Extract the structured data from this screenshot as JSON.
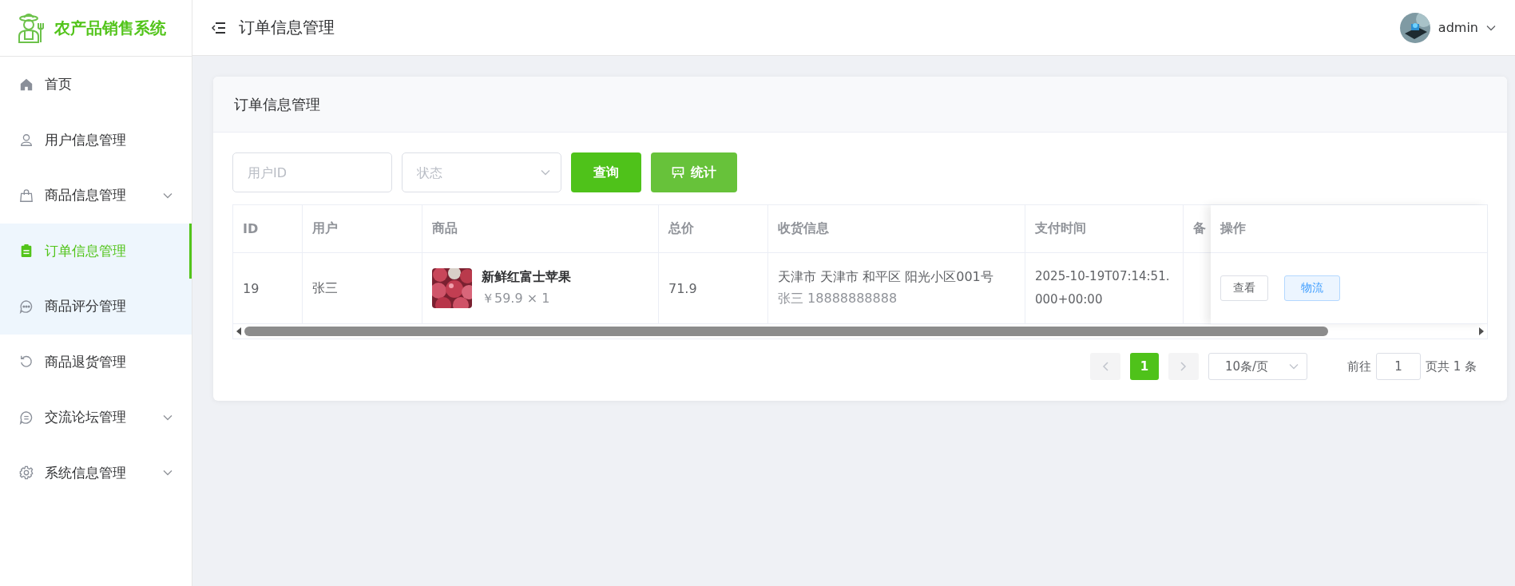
{
  "app": {
    "title": "农产品销售系统"
  },
  "sidebar": {
    "items": [
      {
        "label": "首页",
        "kind": "home",
        "expandable": false,
        "selected": false,
        "hovered": false
      },
      {
        "label": "用户信息管理",
        "kind": "user",
        "expandable": false,
        "selected": false,
        "hovered": false
      },
      {
        "label": "商品信息管理",
        "kind": "bag",
        "expandable": true,
        "selected": false,
        "hovered": false
      },
      {
        "label": "订单信息管理",
        "kind": "clipboard",
        "expandable": false,
        "selected": true,
        "hovered": false
      },
      {
        "label": "商品评分管理",
        "kind": "chat-dots",
        "expandable": false,
        "selected": false,
        "hovered": true
      },
      {
        "label": "商品退货管理",
        "kind": "refresh",
        "expandable": false,
        "selected": false,
        "hovered": false
      },
      {
        "label": "交流论坛管理",
        "kind": "chat-lines",
        "expandable": true,
        "selected": false,
        "hovered": false
      },
      {
        "label": "系统信息管理",
        "kind": "gear",
        "expandable": true,
        "selected": false,
        "hovered": false
      }
    ]
  },
  "header": {
    "title": "订单信息管理",
    "user": "admin"
  },
  "card": {
    "title": "订单信息管理"
  },
  "filters": {
    "user_id": {
      "placeholder": "用户ID"
    },
    "status": {
      "placeholder": "状态"
    }
  },
  "buttons": [
    {
      "label": "查询",
      "kind": "query"
    },
    {
      "label": "统计",
      "kind": "stats"
    }
  ],
  "table": {
    "columns": [
      "ID",
      "用户",
      "商品",
      "总价",
      "收货信息",
      "支付时间",
      "备"
    ],
    "actions_header": "操作",
    "rows": [
      {
        "id": "19",
        "user": "张三",
        "product_name": "新鲜红富士苹果",
        "product_price": "￥59.9 × 1",
        "total": "71.9",
        "address": "天津市 天津市 和平区 阳光小区001号",
        "contact": "张三 18888888888",
        "paid_at": "2025-10-19T07:14:51.000+00:00",
        "actions": [
          {
            "label": "查看",
            "kind": "default"
          },
          {
            "label": "物流",
            "kind": "primary"
          }
        ]
      }
    ]
  },
  "pagination": {
    "pages": [
      {
        "label": "1",
        "selected": true
      }
    ],
    "page_size": "10条/页",
    "goto_label": "前往",
    "goto_value": "1",
    "total": "页共 1 条"
  }
}
